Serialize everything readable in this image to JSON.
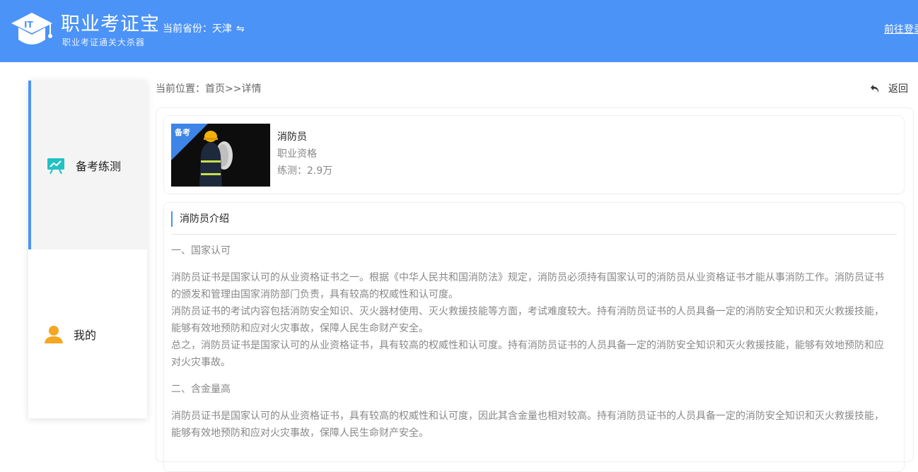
{
  "header": {
    "logo_title": "职业考证宝",
    "logo_subtitle": "职业考证通关大杀器",
    "province_label": "当前省份：天津",
    "province_swap_icon": "⇋",
    "login_link": "前往登录"
  },
  "sidebar": {
    "items": [
      {
        "label": "备考练测",
        "icon": "presentation-chart-icon",
        "active": true
      },
      {
        "label": "我的",
        "icon": "user-icon",
        "active": false
      }
    ]
  },
  "breadcrumb": "当前位置：首页>>详情",
  "back_label": "返回",
  "course": {
    "badge": "备考",
    "name": "消防员",
    "category": "职业资格",
    "practice_count": "练测：2.9万"
  },
  "intro": {
    "title": "消防员介绍",
    "sections": [
      {
        "heading": "一、国家认可",
        "paragraphs": [
          "消防员证书是国家认可的从业资格证书之一。根据《中华人民共和国消防法》规定，消防员必须持有国家认可的消防员从业资格证书才能从事消防工作。消防员证书的颁发和管理由国家消防部门负责，具有较高的权威性和认可度。",
          "消防员证书的考试内容包括消防安全知识、灭火器材使用、灭火救援技能等方面，考试难度较大。持有消防员证书的人员具备一定的消防安全知识和灭火救援技能，能够有效地预防和应对火灾事故，保障人民生命财产安全。",
          "总之，消防员证书是国家认可的从业资格证书，具有较高的权威性和认可度。持有消防员证书的人员具备一定的消防安全知识和灭火救援技能，能够有效地预防和应对火灾事故。"
        ]
      },
      {
        "heading": "二、含金量高",
        "paragraphs": [
          "消防员证书是国家认可的从业资格证书，具有较高的权威性和认可度，因此其含金量也相对较高。持有消防员证书的人员具备一定的消防安全知识和灭火救援技能，能够有效地预防和应对火灾事故，保障人民生命财产安全。"
        ]
      }
    ]
  },
  "colors": {
    "header_bg": "#4c93f7",
    "accent": "#4c93f7",
    "sidebar_active_bg": "#f4f4f4",
    "body_text": "#888888"
  }
}
